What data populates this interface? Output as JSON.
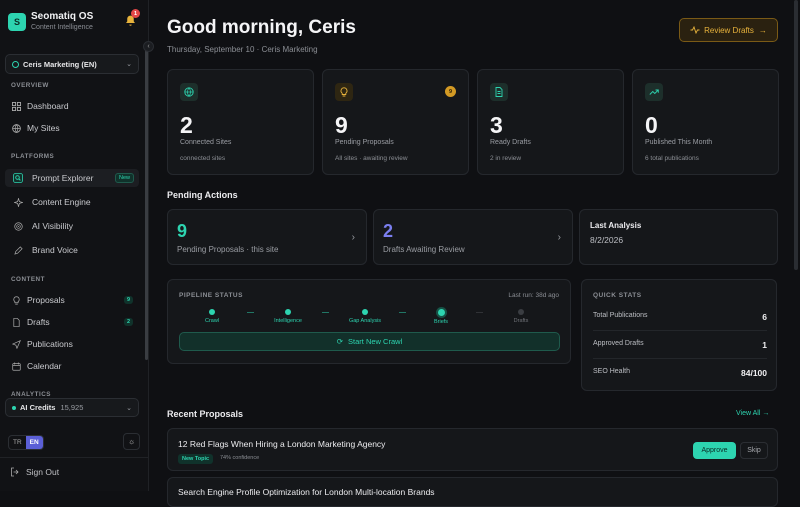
{
  "app": {
    "name": "Seomatiq OS",
    "subtitle": "Content Intelligence",
    "notification_count": "1"
  },
  "workspace": {
    "label": "Ceris Marketing (EN)"
  },
  "sidebar": {
    "overview_title": "OVERVIEW",
    "overview": [
      {
        "label": "Dashboard",
        "icon": "grid-icon"
      },
      {
        "label": "My Sites",
        "icon": "globe-icon"
      }
    ],
    "platforms_title": "PLATFORMS",
    "platforms": [
      {
        "label": "Prompt Explorer",
        "badge": "New",
        "icon": "prompt-icon"
      },
      {
        "label": "Content Engine",
        "icon": "sparkle-icon"
      },
      {
        "label": "AI Visibility",
        "icon": "radar-icon"
      },
      {
        "label": "Brand Voice",
        "icon": "pen-icon"
      }
    ],
    "content_title": "CONTENT",
    "content": [
      {
        "label": "Proposals",
        "count": "9",
        "icon": "lightbulb-icon"
      },
      {
        "label": "Drafts",
        "count": "2",
        "icon": "file-icon"
      },
      {
        "label": "Publications",
        "icon": "send-icon"
      },
      {
        "label": "Calendar",
        "icon": "calendar-icon"
      }
    ],
    "analytics_title": "ANALYTICS",
    "credits": {
      "label": "AI Credits",
      "value": "15,925"
    },
    "lang": {
      "tr": "TR",
      "en": "EN"
    },
    "signout": "Sign Out"
  },
  "header": {
    "greeting": "Good morning, Ceris",
    "subtitle": "Thursday, September 10 · Ceris Marketing",
    "review_button": "Review Drafts"
  },
  "stats": [
    {
      "value": "2",
      "label": "Connected Sites",
      "detail": "connected sites",
      "icon": "globe-icon"
    },
    {
      "value": "9",
      "label": "Pending Proposals",
      "detail": "All sites · awaiting review",
      "badge": "9",
      "icon": "lightbulb-icon"
    },
    {
      "value": "3",
      "label": "Ready Drafts",
      "detail": "2 in review",
      "icon": "file-icon"
    },
    {
      "value": "0",
      "label": "Published This Month",
      "detail": "6 total publications",
      "icon": "trend-icon"
    }
  ],
  "pending": {
    "title": "Pending Actions",
    "items": [
      {
        "value": "9",
        "label": "Pending Proposals · this site",
        "color": "#2dd4b0"
      },
      {
        "value": "2",
        "label": "Drafts Awaiting Review",
        "color": "#7b7ff0"
      }
    ],
    "last_analysis": {
      "title": "Last Analysis",
      "date": "8/2/2026"
    }
  },
  "pipeline": {
    "title": "PIPELINE STATUS",
    "last_run": "Last run: 38d ago",
    "steps": [
      "Crawl",
      "Intelligence",
      "Gap Analysis",
      "Briefs",
      "Drafts"
    ],
    "button": "Start New Crawl"
  },
  "quick_stats": {
    "title": "QUICK STATS",
    "rows": [
      {
        "label": "Total Publications",
        "value": "6"
      },
      {
        "label": "Approved Drafts",
        "value": "1"
      },
      {
        "label": "SEO Health",
        "value": "84/100"
      }
    ]
  },
  "recent": {
    "title": "Recent Proposals",
    "view_all": "View All →",
    "items": [
      {
        "title": "12 Red Flags When Hiring a London Marketing Agency",
        "tag": "New Topic",
        "confidence": "74% confidence",
        "approve": "Approve",
        "skip": "Skip"
      },
      {
        "title": "Search Engine Profile Optimization for London Multi-location Brands"
      }
    ]
  },
  "colors": {
    "accent": "#2dd4b0",
    "warning": "#e8b33c",
    "indigo": "#7b7ff0"
  }
}
